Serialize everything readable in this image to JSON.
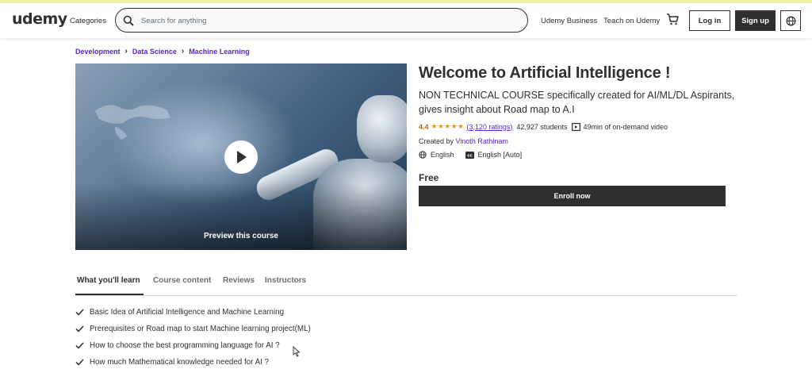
{
  "header": {
    "logo": "udemy",
    "categories": "Categories",
    "search_placeholder": "Search for anything",
    "business": "Udemy Business",
    "teach": "Teach on Udemy",
    "login": "Log in",
    "signup": "Sign up"
  },
  "breadcrumb": [
    "Development",
    "Data Science",
    "Machine Learning"
  ],
  "video": {
    "preview_label": "Preview this course"
  },
  "course": {
    "title": "Welcome to Artificial Intelligence !",
    "subtitle": "NON TECHNICAL COURSE specifically created for AI/ML/DL Aspirants, gives insight about Road map to A.I",
    "rating": "4.4",
    "stars": 4.4,
    "ratings_count": "(3,120 ratings)",
    "students": "42,927 students",
    "duration": "49min of on-demand video",
    "created_by_label": "Created by",
    "instructor": "Vinoth Rathinam",
    "language": "English",
    "captions": "English [Auto]",
    "price": "Free",
    "enroll": "Enroll now"
  },
  "tabs": [
    "What you'll learn",
    "Course content",
    "Reviews",
    "Instructors"
  ],
  "learn": [
    "Basic Idea of Artificial Intelligence and Machine Learning",
    "Prerequisites or Road map to start Machine learning project(ML)",
    "How to choose the best programming language for AI ?",
    "How much Mathematical knowledge needed for AI ?"
  ],
  "colors": {
    "accent_purple": "#5624d0",
    "rating_orange": "#b4690e",
    "star": "#e59819",
    "dark": "#2d2f31"
  }
}
